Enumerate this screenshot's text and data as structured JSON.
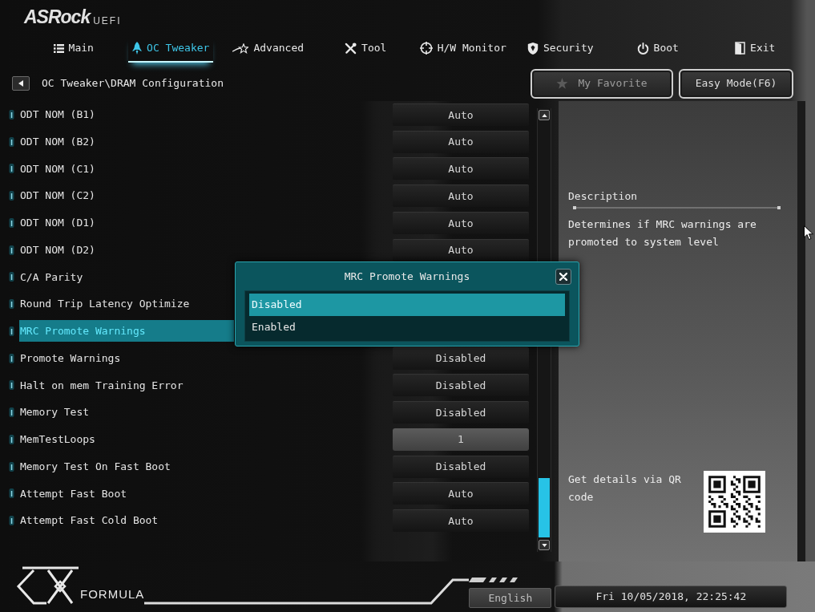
{
  "header": {
    "logo": "ASRock",
    "logo_suffix": "UEFI"
  },
  "tabs": [
    {
      "label": "Main",
      "selected": false
    },
    {
      "label": "OC Tweaker",
      "selected": true
    },
    {
      "label": "Advanced",
      "selected": false
    },
    {
      "label": "Tool",
      "selected": false
    },
    {
      "label": "H/W Monitor",
      "selected": false
    },
    {
      "label": "Security",
      "selected": false
    },
    {
      "label": "Boot",
      "selected": false
    },
    {
      "label": "Exit",
      "selected": false
    }
  ],
  "breadcrumb": {
    "path": "OC Tweaker\\DRAM Configuration"
  },
  "toolbar_buttons": [
    "My Favorite",
    "Easy Mode(F6)"
  ],
  "settings": [
    {
      "label": "ODT NOM (B1)",
      "value": "Auto",
      "kind": "option",
      "selected": false
    },
    {
      "label": "ODT NOM (B2)",
      "value": "Auto",
      "kind": "option",
      "selected": false
    },
    {
      "label": "ODT NOM (C1)",
      "value": "Auto",
      "kind": "option",
      "selected": false
    },
    {
      "label": "ODT NOM (C2)",
      "value": "Auto",
      "kind": "option",
      "selected": false
    },
    {
      "label": "ODT NOM (D1)",
      "value": "Auto",
      "kind": "option",
      "selected": false
    },
    {
      "label": "ODT NOM (D2)",
      "value": "Auto",
      "kind": "option",
      "selected": false
    },
    {
      "label": "C/A Parity",
      "selected": false
    },
    {
      "label": "Round Trip Latency Optimize",
      "selected": false
    },
    {
      "label": "MRC Promote Warnings",
      "selected": true
    },
    {
      "label": "Promote Warnings",
      "value": "Disabled",
      "kind": "option",
      "selected": false
    },
    {
      "label": "Halt on mem Training Error",
      "value": "Disabled",
      "kind": "option",
      "selected": false
    },
    {
      "label": "Memory Test",
      "value": "Disabled",
      "kind": "option",
      "selected": false
    },
    {
      "label": "MemTestLoops",
      "value": "1",
      "kind": "number",
      "selected": false
    },
    {
      "label": "Memory Test On Fast Boot",
      "value": "Disabled",
      "kind": "option",
      "selected": false
    },
    {
      "label": "Attempt Fast Boot",
      "value": "Auto",
      "kind": "option",
      "selected": false
    },
    {
      "label": "Attempt Fast Cold Boot",
      "value": "Auto",
      "kind": "option",
      "selected": false
    }
  ],
  "popup": {
    "title": "MRC Promote Warnings",
    "options": [
      {
        "label": "Disabled",
        "selected": true
      },
      {
        "label": "Enabled",
        "selected": false
      }
    ]
  },
  "description": {
    "heading": "Description",
    "text": "Determines if MRC warnings are promoted to system level"
  },
  "qr_panel": {
    "text": "Get details via QR code"
  },
  "footer": {
    "brand": "FORMULA",
    "language": "English",
    "datetime": "Fri 10/05/2018, 22:25:42"
  }
}
